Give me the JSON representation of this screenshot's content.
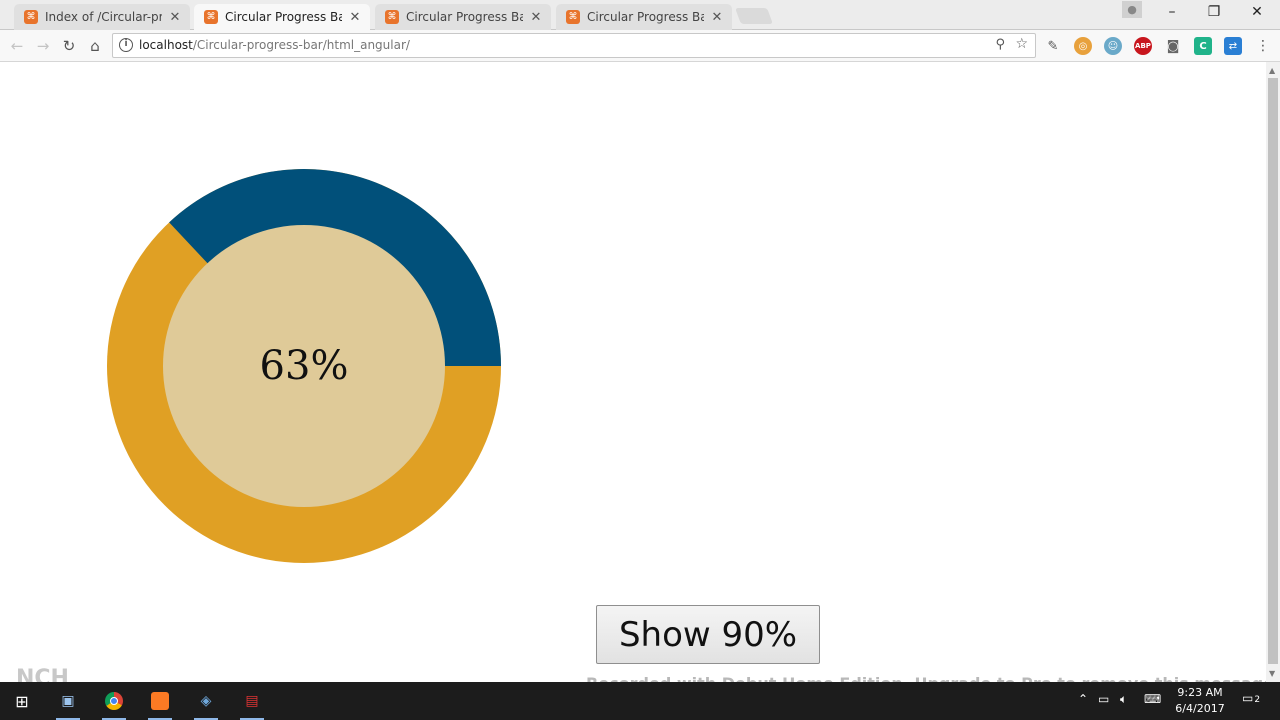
{
  "browser": {
    "tabs": [
      {
        "title": "Index of /Circular-progre",
        "active": false
      },
      {
        "title": "Circular Progress Bar",
        "active": true
      },
      {
        "title": "Circular Progress Bar",
        "active": false
      },
      {
        "title": "Circular Progress Bar",
        "active": false
      }
    ],
    "url_host": "localhost",
    "url_path": "/Circular-progress-bar/html_angular/"
  },
  "page": {
    "progress_label": "63%",
    "progress_value": 63,
    "button_label": "Show 90%",
    "watermark": "Recorded with Debut Home Edition. Upgrade to Pro to remove this message.",
    "vch_logo": "NCH"
  },
  "colors": {
    "progress": "#01507a",
    "track": "#e0a024",
    "inner": "#dfca98"
  },
  "taskbar": {
    "time": "9:23 AM",
    "date": "6/4/2017",
    "notification_count": "2"
  }
}
